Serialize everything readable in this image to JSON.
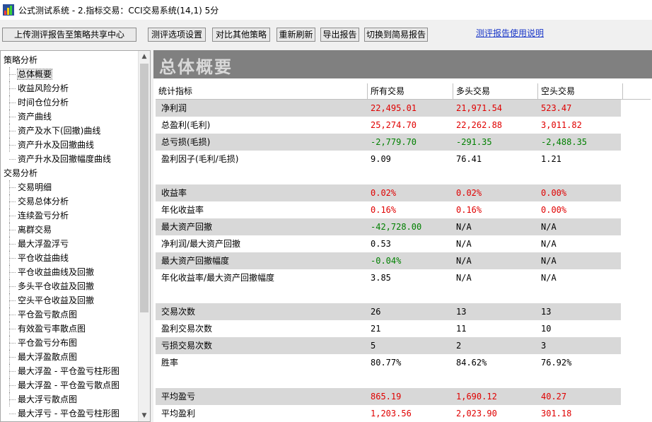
{
  "window": {
    "title": "公式测试系统 - 2.指标交易：CCI交易系统(14,1) 5分"
  },
  "toolbar": {
    "upload_label": "上传测评报告至策略共享中心",
    "options_label": "测评选项设置",
    "compare_label": "对比其他策略",
    "refresh_label": "重新刷新",
    "export_label": "导出报告",
    "simple_label": "切换到简易报告",
    "help_link": "测评报告使用说明"
  },
  "sidebar": {
    "groups": [
      {
        "label": "策略分析",
        "items": [
          "总体概要",
          "收益风险分析",
          "时间仓位分析",
          "资产曲线",
          "资产及水下(回撤)曲线",
          "资产升水及回撤曲线",
          "资产升水及回撤幅度曲线"
        ]
      },
      {
        "label": "交易分析",
        "items": [
          "交易明细",
          "交易总体分析",
          "连续盈亏分析",
          "离群交易",
          "最大浮盈浮亏",
          "平仓收益曲线",
          "平仓收益曲线及回撤",
          "多头平仓收益及回撤",
          "空头平仓收益及回撤",
          "平仓盈亏散点图",
          "有效盈亏率散点图",
          "平仓盈亏分布图",
          "最大浮盈散点图",
          "最大浮盈 - 平仓盈亏柱形图",
          "最大浮盈 - 平仓盈亏散点图",
          "最大浮亏散点图",
          "最大浮亏 - 平仓盈亏柱形图"
        ]
      }
    ],
    "selected": "总体概要"
  },
  "main": {
    "heading": "总体概要",
    "columns": [
      "统计指标",
      "所有交易",
      "多头交易",
      "空头交易"
    ],
    "rows": [
      {
        "label": "净利润",
        "values": [
          "22,495.01",
          "21,971.54",
          "523.47"
        ],
        "colors": [
          "red",
          "red",
          "red"
        ],
        "shade": true
      },
      {
        "label": "总盈利(毛利)",
        "values": [
          "25,274.70",
          "22,262.88",
          "3,011.82"
        ],
        "colors": [
          "red",
          "red",
          "red"
        ],
        "shade": false
      },
      {
        "label": "总亏损(毛损)",
        "values": [
          "-2,779.70",
          "-291.35",
          "-2,488.35"
        ],
        "colors": [
          "green",
          "green",
          "green"
        ],
        "shade": true
      },
      {
        "label": "盈利因子(毛利/毛损)",
        "values": [
          "9.09",
          "76.41",
          "1.21"
        ],
        "colors": [
          "black",
          "black",
          "black"
        ],
        "shade": false
      },
      {
        "label": "",
        "values": [
          "",
          "",
          ""
        ],
        "colors": [
          "black",
          "black",
          "black"
        ],
        "shade": false
      },
      {
        "label": "收益率",
        "values": [
          "0.02%",
          "0.02%",
          "0.00%"
        ],
        "colors": [
          "red",
          "red",
          "red"
        ],
        "shade": true
      },
      {
        "label": "年化收益率",
        "values": [
          "0.16%",
          "0.16%",
          "0.00%"
        ],
        "colors": [
          "red",
          "red",
          "red"
        ],
        "shade": false
      },
      {
        "label": "最大资产回撤",
        "values": [
          "-42,728.00",
          "N/A",
          "N/A"
        ],
        "colors": [
          "green",
          "black",
          "black"
        ],
        "shade": true
      },
      {
        "label": "净利润/最大资产回撤",
        "values": [
          "0.53",
          "N/A",
          "N/A"
        ],
        "colors": [
          "black",
          "black",
          "black"
        ],
        "shade": false
      },
      {
        "label": "最大资产回撤幅度",
        "values": [
          "-0.04%",
          "N/A",
          "N/A"
        ],
        "colors": [
          "green",
          "black",
          "black"
        ],
        "shade": true
      },
      {
        "label": "年化收益率/最大资产回撤幅度",
        "values": [
          "3.85",
          "N/A",
          "N/A"
        ],
        "colors": [
          "black",
          "black",
          "black"
        ],
        "shade": false
      },
      {
        "label": "",
        "values": [
          "",
          "",
          ""
        ],
        "colors": [
          "black",
          "black",
          "black"
        ],
        "shade": false
      },
      {
        "label": "交易次数",
        "values": [
          "26",
          "13",
          "13"
        ],
        "colors": [
          "black",
          "black",
          "black"
        ],
        "shade": true
      },
      {
        "label": "盈利交易次数",
        "values": [
          "21",
          "11",
          "10"
        ],
        "colors": [
          "black",
          "black",
          "black"
        ],
        "shade": false
      },
      {
        "label": "亏损交易次数",
        "values": [
          "5",
          "2",
          "3"
        ],
        "colors": [
          "black",
          "black",
          "black"
        ],
        "shade": true
      },
      {
        "label": "胜率",
        "values": [
          "80.77%",
          "84.62%",
          "76.92%"
        ],
        "colors": [
          "black",
          "black",
          "black"
        ],
        "shade": false
      },
      {
        "label": "",
        "values": [
          "",
          "",
          ""
        ],
        "colors": [
          "black",
          "black",
          "black"
        ],
        "shade": false
      },
      {
        "label": "平均盈亏",
        "values": [
          "865.19",
          "1,690.12",
          "40.27"
        ],
        "colors": [
          "red",
          "red",
          "red"
        ],
        "shade": true
      },
      {
        "label": "平均盈利",
        "values": [
          "1,203.56",
          "2,023.90",
          "301.18"
        ],
        "colors": [
          "red",
          "red",
          "red"
        ],
        "shade": false
      }
    ]
  }
}
